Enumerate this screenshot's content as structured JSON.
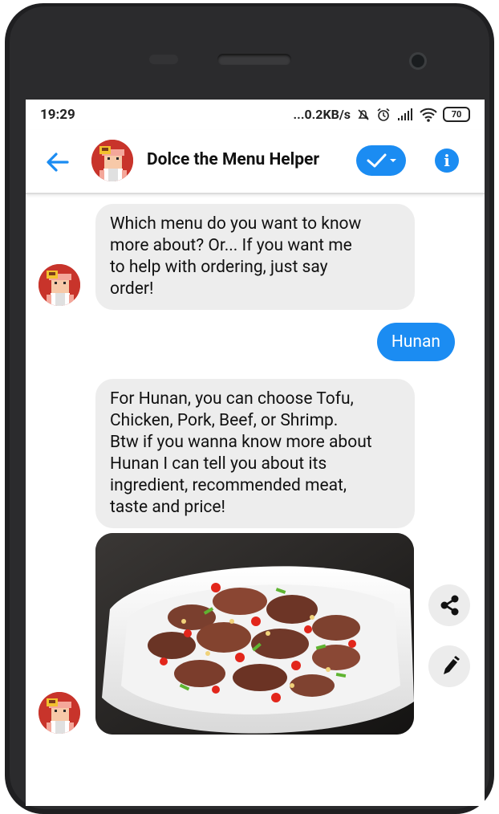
{
  "status_bar": {
    "time": "19:29",
    "network_speed": "...0.2KB/s",
    "battery": "70"
  },
  "header": {
    "title": "Dolce the Menu Helper",
    "back_icon": "back-arrow-icon",
    "check_icon": "checkmark-dropdown-icon",
    "info_icon": "info-icon"
  },
  "messages": [
    {
      "from": "bot",
      "lines": [
        "Which menu do you want to know",
        "more about?  Or... If you want me",
        "to help with ordering, just say",
        "order!"
      ]
    },
    {
      "from": "user",
      "text": "Hunan"
    },
    {
      "from": "bot",
      "lines": [
        "For Hunan, you can choose Tofu,",
        "Chicken, Pork, Beef, or Shrimp.",
        "Btw if you wanna know more about",
        "Hunan I can tell you about its",
        "ingredient, recommended meat,",
        "taste and price!"
      ]
    },
    {
      "from": "bot",
      "image": "hunan-dish-photo"
    }
  ],
  "actions": {
    "share_icon": "share-icon",
    "edit_icon": "pencil-icon"
  },
  "colors": {
    "accent": "#1b8cf2",
    "bubble_in": "#ededed",
    "avatar_bg": "#c8342b"
  }
}
